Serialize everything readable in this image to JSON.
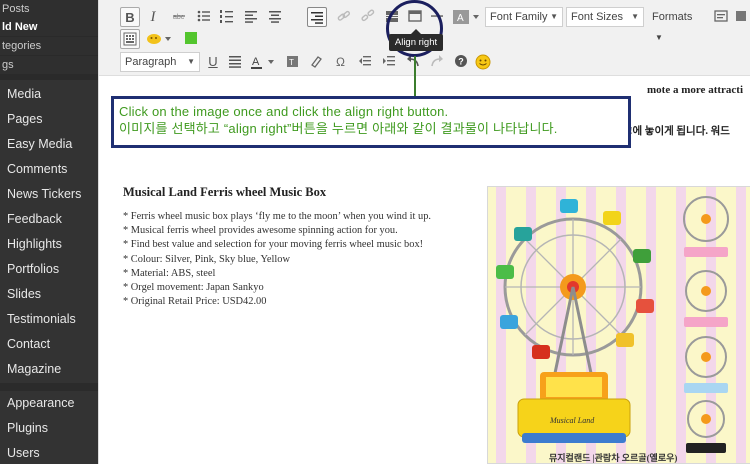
{
  "sidebar": {
    "submenu": [
      "Posts",
      "ld New",
      "tegories",
      "gs"
    ],
    "items": [
      "Media",
      "Pages",
      "Easy Media",
      "Comments",
      "News Tickers",
      "Feedback",
      "Highlights",
      "Portfolios",
      "Slides",
      "Testimonials",
      "Contact",
      "Magazine",
      "Appearance",
      "Plugins",
      "Users"
    ]
  },
  "toolbar": {
    "row1": {
      "bold": "B",
      "italic": "I",
      "font_family": "Font Family",
      "font_sizes": "Font Sizes",
      "formats": "Formats"
    },
    "row3": {
      "paragraph": "Paragraph",
      "underline": "U",
      "text_color_letter": "A"
    },
    "tooltip": "Align right",
    "icons": [
      "bold-icon",
      "italic-icon",
      "strikethrough-icon",
      "bullet-list-icon",
      "numbered-list-icon",
      "align-left-icon",
      "align-center-icon",
      "align-right-icon",
      "link-icon",
      "unlink-icon",
      "insert-more-icon",
      "fullscreen-icon",
      "horizontal-rule-icon",
      "text-color-icon",
      "kitchen-sink-icon",
      "emoticon-icon",
      "green-swatch-icon",
      "underline-icon",
      "justify-icon",
      "paste-text-icon",
      "eraser-icon",
      "special-char-icon",
      "outdent-icon",
      "indent-icon",
      "undo-icon",
      "redo-icon",
      "help-icon",
      "smiley-icon"
    ]
  },
  "content": {
    "truncated_line1": "mote a more attracti",
    "truncated_line2": "!에 놓이게 됩니다. 워드",
    "callout": {
      "line1": "Click on the image once and click the align right button.",
      "line2": "이미지를 선택하고 “align right”버튼을 누르면 아래와 같이 결과물이 나타납니다."
    },
    "product_title": "Musical Land Ferris wheel Music Box",
    "bullets": [
      "* Ferris wheel music box plays ‘fly me to the moon’ when you wind it up.",
      "* Musical ferris wheel provides awesome spinning action for you.",
      "* Find best value and selection for your moving ferris wheel music box!",
      "* Colour: Silver, Pink, Sky blue, Yellow",
      "* Material: ABS, steel",
      "* Orgel movement: Japan Sankyo",
      "* Original Retail Price: USD42.00"
    ],
    "image_caption": "뮤지컬랜드 |관람차 오르골(옐로우)",
    "image_logo_text": "Musical Land"
  },
  "colors": {
    "sidebar_bg": "#333333",
    "callout_border": "#1f2f72",
    "callout_text": "#3f9a1f",
    "annotation_circle": "#1b1f5e",
    "image_bg": "#fbf7c9",
    "image_stripe": "#f3d7ea"
  }
}
